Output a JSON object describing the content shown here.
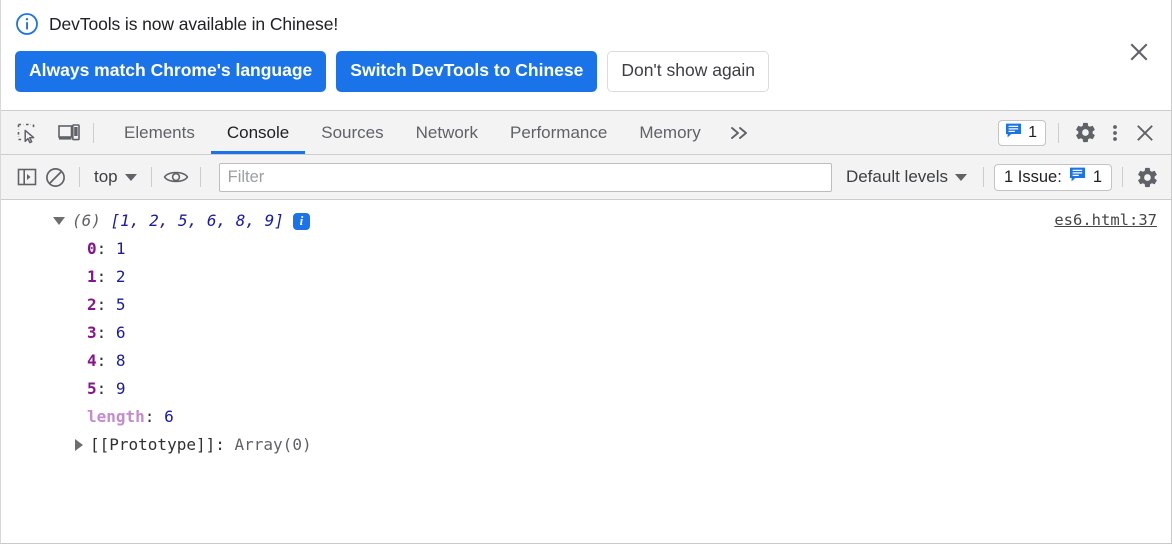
{
  "banner": {
    "icon": "info-circle-icon",
    "message": "DevTools is now available in Chinese!",
    "primary_button_1": "Always match Chrome's language",
    "primary_button_2": "Switch DevTools to Chinese",
    "secondary_button": "Don't show again",
    "close_icon": "close-icon",
    "accent_color": "#1a73e8"
  },
  "tabbar": {
    "inspect_icon": "inspect-element-icon",
    "device_icon": "device-toolbar-icon",
    "tabs": [
      {
        "label": "Elements",
        "active": false
      },
      {
        "label": "Console",
        "active": true
      },
      {
        "label": "Sources",
        "active": false
      },
      {
        "label": "Network",
        "active": false
      },
      {
        "label": "Performance",
        "active": false
      },
      {
        "label": "Memory",
        "active": false
      }
    ],
    "more_tabs_icon": "chevron-double-right-icon",
    "issues_count": "1",
    "issues_icon": "issues-speech-bubble-icon",
    "settings_icon": "gear-icon",
    "more_options_icon": "kebab-menu-icon",
    "close_icon": "close-icon",
    "active_underline_color": "#1a73e8"
  },
  "console_toolbar": {
    "sidebar_icon": "console-sidebar-toggle-icon",
    "clear_icon": "clear-console-icon",
    "context": "top",
    "context_caret": "chevron-down-icon",
    "eye_icon": "live-expression-eye-icon",
    "filter_placeholder": "Filter",
    "filter_value": "",
    "levels": "Default levels",
    "levels_caret": "chevron-down-icon",
    "issues_label": "1 Issue:",
    "issues_icon": "issues-speech-bubble-icon",
    "issues_count": "1",
    "settings_icon": "console-settings-gear-icon"
  },
  "console": {
    "array_header": {
      "expand_icon": "triangle-down-icon",
      "length_label": "(6)",
      "preview": "[1, 2, 5, 6, 8, 9]",
      "info_badge": "i",
      "source": "es6.html:37"
    },
    "entries": [
      {
        "key": "0",
        "colon": ":",
        "value": "1"
      },
      {
        "key": "1",
        "colon": ":",
        "value": "2"
      },
      {
        "key": "2",
        "colon": ":",
        "value": "5"
      },
      {
        "key": "3",
        "colon": ":",
        "value": "6"
      },
      {
        "key": "4",
        "colon": ":",
        "value": "8"
      },
      {
        "key": "5",
        "colon": ":",
        "value": "9"
      }
    ],
    "length_entry": {
      "key": "length",
      "colon": ":",
      "value": "6"
    },
    "prototype_entry": {
      "expand_icon": "triangle-right-icon",
      "key": "[[Prototype]]",
      "colon": ":",
      "value": "Array(0)"
    },
    "prompt_chevron": "›",
    "prompt_value": ""
  }
}
